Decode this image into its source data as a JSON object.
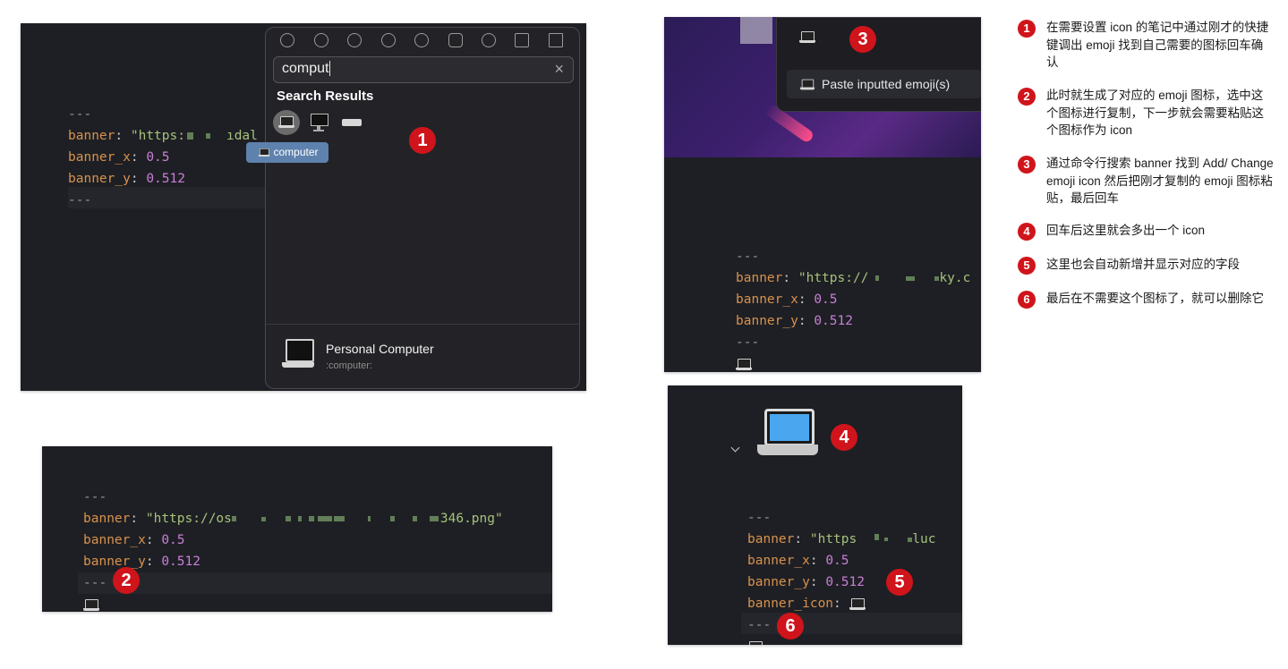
{
  "frontmatter": {
    "sep": "---",
    "banner_key": "banner",
    "banner_x_key": "banner_x",
    "banner_x_value": "0.5",
    "banner_y_key": "banner_y",
    "banner_y_value": "0.512",
    "banner_icon_key": "banner_icon",
    "url_panel1": "\"https:",
    "url_panel1_tail": "ıdal",
    "url_panel2": "\"https://os",
    "url_panel2_tail": "346.png\"",
    "url_panel3": "\"https://",
    "url_panel3_tail": "ky.c",
    "url_panel4": "\"https",
    "url_panel4_tail": "luc"
  },
  "picker": {
    "query": "comput",
    "results_heading": "Search Results",
    "tooltip": "computer",
    "detail_name": "Personal Computer",
    "detail_shortcode": ":computer:"
  },
  "command": {
    "paste_label": "Paste inputted emoji(s)"
  },
  "badges": [
    "1",
    "2",
    "3",
    "4",
    "5",
    "6"
  ],
  "legend": [
    {
      "num": "1",
      "text": "在需要设置 icon 的笔记中通过刚才的快捷键调出 emoji 找到自己需要的图标回车确认"
    },
    {
      "num": "2",
      "text": "此时就生成了对应的 emoji 图标，选中这个图标进行复制，下一步就会需要粘贴这个图标作为 icon"
    },
    {
      "num": "3",
      "text": "通过命令行搜索 banner 找到 Add/ Change emoji icon 然后把刚才复制的 emoji 图标粘贴，最后回车"
    },
    {
      "num": "4",
      "text": "回车后这里就会多出一个 icon"
    },
    {
      "num": "5",
      "text": "这里也会自动新增并显示对应的字段"
    },
    {
      "num": "6",
      "text": "最后在不需要这个图标了，就可以删除它"
    }
  ],
  "colors": {
    "badge": "#d0141b",
    "key": "#d8924d",
    "number": "#c97fd8",
    "string": "#a7c27b",
    "panel": "#1e1f24"
  }
}
